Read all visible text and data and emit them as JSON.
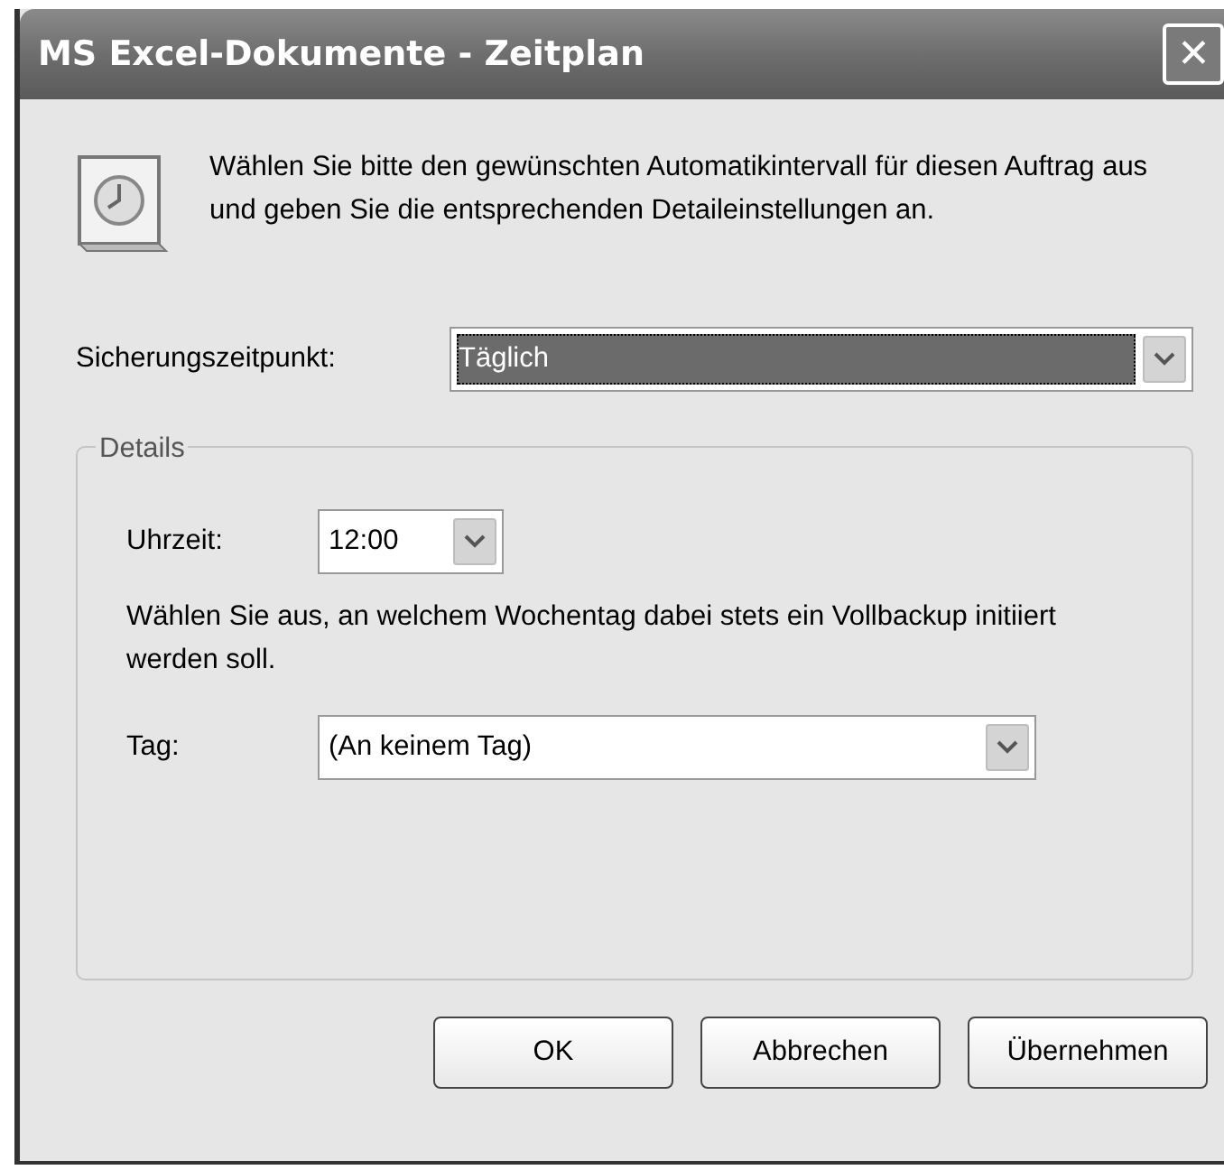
{
  "window": {
    "title": "MS Excel-Dokumente - Zeitplan",
    "close": "✕"
  },
  "intro": "Wählen Sie bitte den gewünschten Automatikintervall für diesen Auftrag aus und geben Sie die entsprechenden Detaileinstellungen an.",
  "schedule": {
    "label": "Sicherungszeitpunkt:",
    "value": "Täglich",
    "focused": true
  },
  "details": {
    "title": "Details",
    "time": {
      "label": "Uhrzeit:",
      "value": "12:00"
    },
    "hint": "Wählen Sie aus, an welchem Wochentag dabei stets ein Vollbackup initiiert werden soll.",
    "day": {
      "label": "Tag:",
      "value": "(An keinem Tag)"
    }
  },
  "buttons": [
    "OK",
    "Abbrechen",
    "Übernehmen"
  ]
}
